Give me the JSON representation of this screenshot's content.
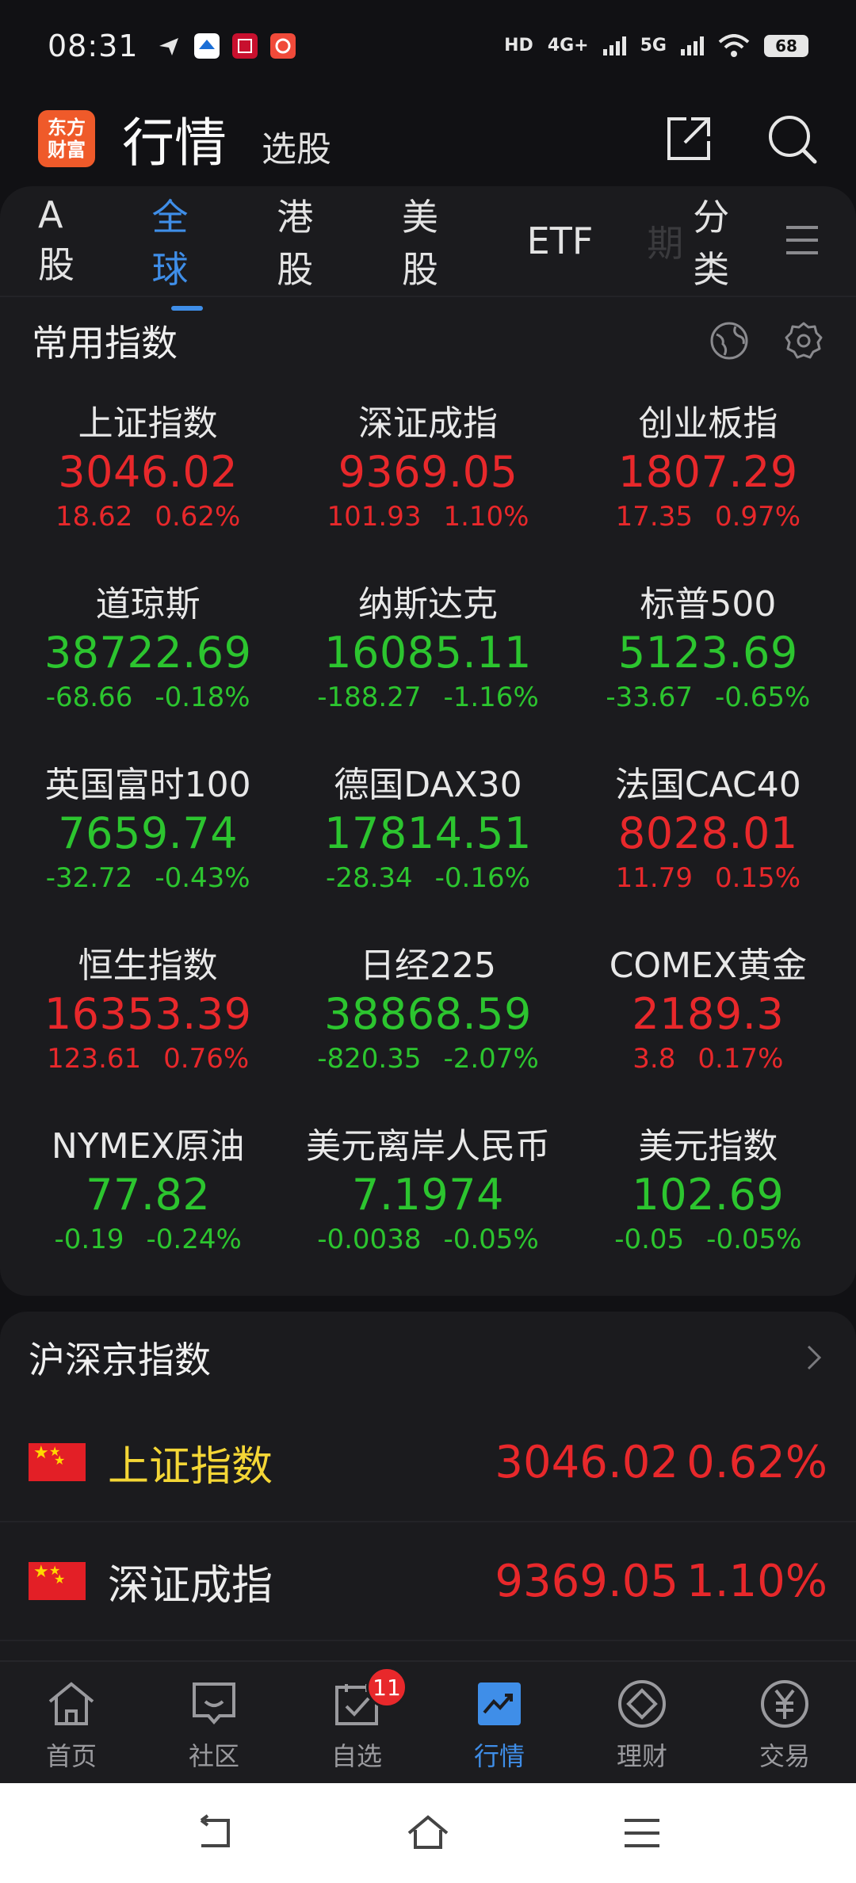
{
  "status_bar": {
    "time": "08:31",
    "network_labels": [
      "HD",
      "4G+",
      "5G"
    ],
    "battery": "68"
  },
  "header": {
    "logo_line1": "东方",
    "logo_line2": "财富",
    "title": "行情",
    "subtitle": "选股"
  },
  "tabs": [
    {
      "label": "A股"
    },
    {
      "label": "全球"
    },
    {
      "label": "港股"
    },
    {
      "label": "美股"
    },
    {
      "label": "ETF"
    },
    {
      "label": "期"
    },
    {
      "label": "分类"
    }
  ],
  "common_indices": {
    "title": "常用指数",
    "items": [
      {
        "name": "上证指数",
        "value": "3046.02",
        "change": "18.62",
        "pct": "0.62%",
        "dir": "up"
      },
      {
        "name": "深证成指",
        "value": "9369.05",
        "change": "101.93",
        "pct": "1.10%",
        "dir": "up"
      },
      {
        "name": "创业板指",
        "value": "1807.29",
        "change": "17.35",
        "pct": "0.97%",
        "dir": "up"
      },
      {
        "name": "道琼斯",
        "value": "38722.69",
        "change": "-68.66",
        "pct": "-0.18%",
        "dir": "down"
      },
      {
        "name": "纳斯达克",
        "value": "16085.11",
        "change": "-188.27",
        "pct": "-1.16%",
        "dir": "down"
      },
      {
        "name": "标普500",
        "value": "5123.69",
        "change": "-33.67",
        "pct": "-0.65%",
        "dir": "down"
      },
      {
        "name": "英国富时100",
        "value": "7659.74",
        "change": "-32.72",
        "pct": "-0.43%",
        "dir": "down"
      },
      {
        "name": "德国DAX30",
        "value": "17814.51",
        "change": "-28.34",
        "pct": "-0.16%",
        "dir": "down"
      },
      {
        "name": "法国CAC40",
        "value": "8028.01",
        "change": "11.79",
        "pct": "0.15%",
        "dir": "up"
      },
      {
        "name": "恒生指数",
        "value": "16353.39",
        "change": "123.61",
        "pct": "0.76%",
        "dir": "up"
      },
      {
        "name": "日经225",
        "value": "38868.59",
        "change": "-820.35",
        "pct": "-2.07%",
        "dir": "down"
      },
      {
        "name": "COMEX黄金",
        "value": "2189.3",
        "change": "3.8",
        "pct": "0.17%",
        "dir": "up"
      },
      {
        "name": "NYMEX原油",
        "value": "77.82",
        "change": "-0.19",
        "pct": "-0.24%",
        "dir": "down"
      },
      {
        "name": "美元离岸人民币",
        "value": "7.1974",
        "change": "-0.0038",
        "pct": "-0.05%",
        "dir": "down"
      },
      {
        "name": "美元指数",
        "value": "102.69",
        "change": "-0.05",
        "pct": "-0.05%",
        "dir": "down"
      }
    ]
  },
  "hs_indices": {
    "title": "沪深京指数",
    "rows": [
      {
        "name": "上证指数",
        "value": "3046.02",
        "pct": "0.62%"
      },
      {
        "name": "深证成指",
        "value": "9369.05",
        "pct": "1.10%"
      }
    ]
  },
  "bottom_nav": [
    {
      "label": "首页",
      "icon": "home-icon"
    },
    {
      "label": "社区",
      "icon": "community-icon"
    },
    {
      "label": "自选",
      "icon": "watchlist-icon",
      "badge": "11"
    },
    {
      "label": "行情",
      "icon": "market-icon"
    },
    {
      "label": "理财",
      "icon": "wealth-icon"
    },
    {
      "label": "交易",
      "icon": "trade-icon"
    }
  ],
  "colors": {
    "up": "#e8282b",
    "down": "#2cc52f",
    "accent": "#3f8ee8",
    "highlight": "#f4d636"
  }
}
